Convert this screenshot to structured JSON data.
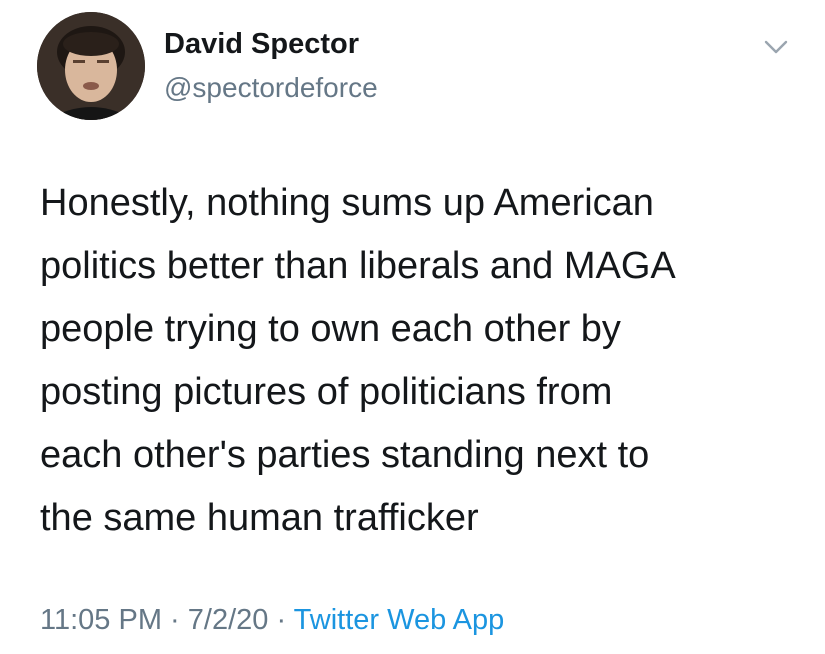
{
  "author": {
    "display_name": "David Spector",
    "handle": "@spectordeforce",
    "avatar_icon": "profile-photo"
  },
  "menu": {
    "icon": "chevron-down-icon"
  },
  "tweet": {
    "lines": [
      "Honestly, nothing sums up American",
      "politics better than liberals and MAGA",
      "people trying to own each other by",
      "posting pictures of politicians from",
      "each other's parties standing next to",
      "the same human trafficker"
    ]
  },
  "meta": {
    "time": "11:05 PM",
    "separator": " · ",
    "date": "7/2/20",
    "source": "Twitter Web App"
  },
  "colors": {
    "text": "#14171a",
    "secondary": "#657786",
    "link": "#1b95e0",
    "background": "#ffffff"
  }
}
